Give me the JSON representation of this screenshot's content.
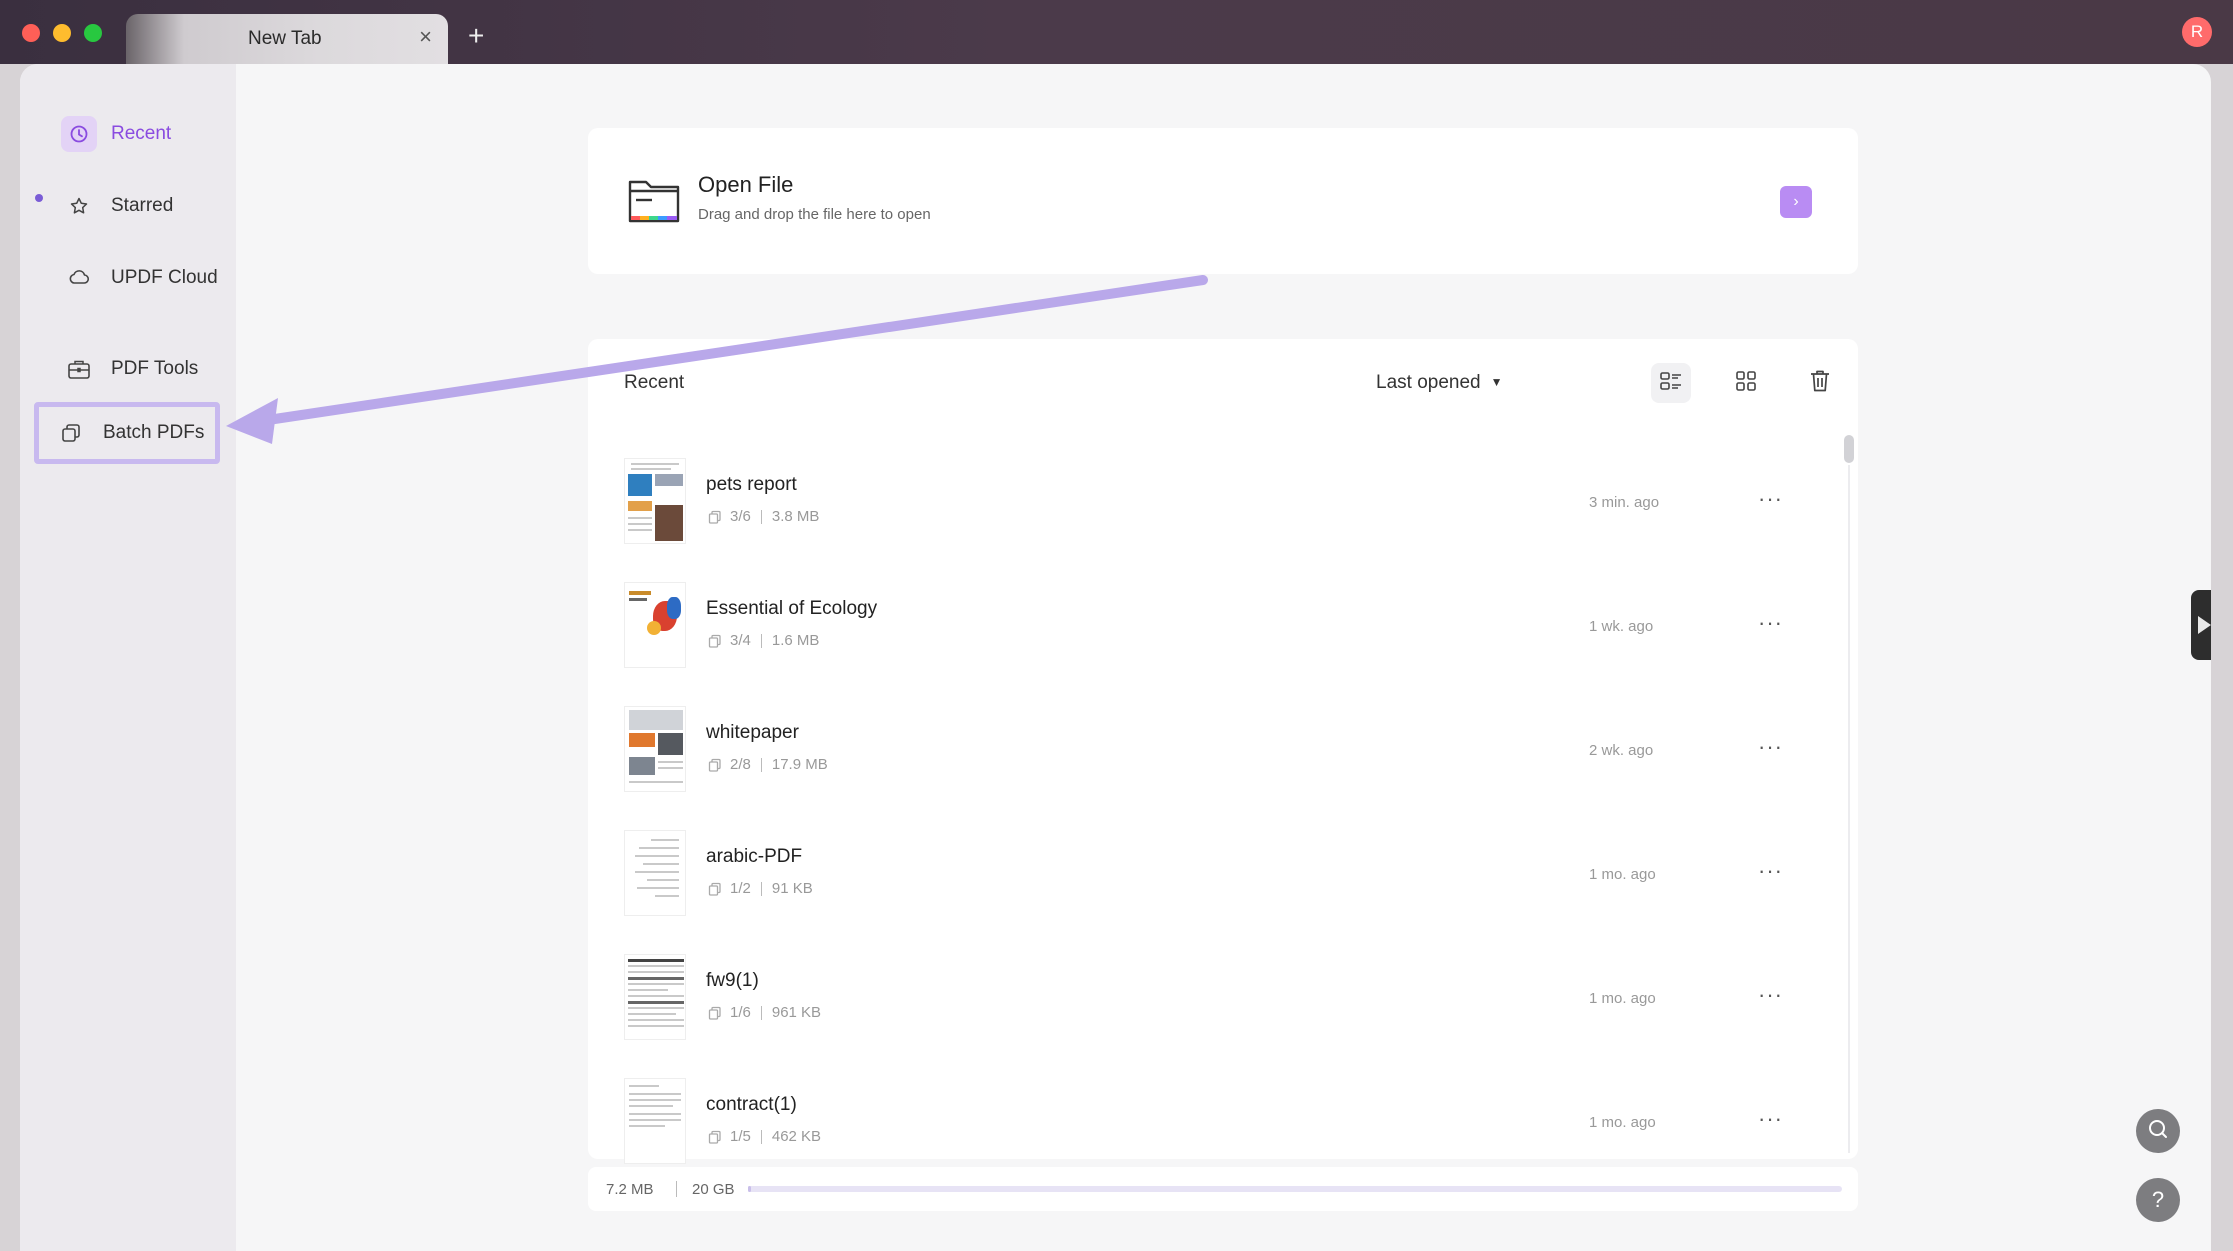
{
  "tab": {
    "title": "New Tab",
    "close": "×",
    "add": "+"
  },
  "user": {
    "avatar_letter": "R"
  },
  "sidebar": {
    "items": [
      {
        "label": "Recent",
        "icon": "clock-icon"
      },
      {
        "label": "Starred",
        "icon": "star-icon"
      },
      {
        "label": "UPDF Cloud",
        "icon": "cloud-icon"
      },
      {
        "label": "PDF Tools",
        "icon": "toolbox-icon"
      },
      {
        "label": "Batch PDFs",
        "icon": "batch-copy-icon"
      }
    ]
  },
  "open_file": {
    "title": "Open File",
    "subtitle": "Drag and drop the file here to open",
    "arrow": "›"
  },
  "recent": {
    "title": "Recent",
    "sort_label": "Last opened",
    "files": [
      {
        "name": "pets report",
        "pages": "3/6",
        "size": "3.8 MB",
        "time": "3 min. ago"
      },
      {
        "name": "Essential of Ecology",
        "pages": "3/4",
        "size": "1.6 MB",
        "time": "1 wk. ago"
      },
      {
        "name": "whitepaper",
        "pages": "2/8",
        "size": "17.9 MB",
        "time": "2 wk. ago"
      },
      {
        "name": "arabic-PDF",
        "pages": "1/2",
        "size": "91 KB",
        "time": "1 mo. ago"
      },
      {
        "name": "fw9(1)",
        "pages": "1/6",
        "size": "961 KB",
        "time": "1 mo. ago"
      },
      {
        "name": "contract(1)",
        "pages": "1/5",
        "size": "462 KB",
        "time": "1 mo. ago"
      }
    ],
    "more_label": "···"
  },
  "storage": {
    "used": "7.2 MB",
    "total": "20 GB",
    "used_fraction": 0.00035
  },
  "help": {
    "label": "?"
  },
  "colors": {
    "accent": "#8a4be0",
    "highlight_box": "#c8b9ef",
    "arrow": "#b9a8ea"
  }
}
